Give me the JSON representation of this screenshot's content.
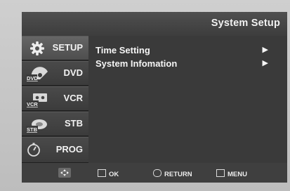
{
  "header": {
    "title": "System Setup"
  },
  "sidebar": {
    "items": [
      {
        "label": "SETUP",
        "icon": "gear-icon",
        "active": true
      },
      {
        "label": "DVD",
        "icon": "dvd-icon",
        "badge": "DVD",
        "active": false
      },
      {
        "label": "VCR",
        "icon": "vcr-icon",
        "badge": "VCR",
        "active": false
      },
      {
        "label": "STB",
        "icon": "stb-icon",
        "badge": "STB",
        "active": false
      },
      {
        "label": "PROG",
        "icon": "stopwatch-icon",
        "active": false
      }
    ]
  },
  "menu": {
    "items": [
      {
        "label": "Time Setting",
        "arrow": "▶"
      },
      {
        "label": "System Infomation",
        "arrow": "▶"
      }
    ]
  },
  "footer": {
    "nav_icon": "directional-pad-icon",
    "ok": "OK",
    "return": "RETURN",
    "menu": "MENU"
  }
}
